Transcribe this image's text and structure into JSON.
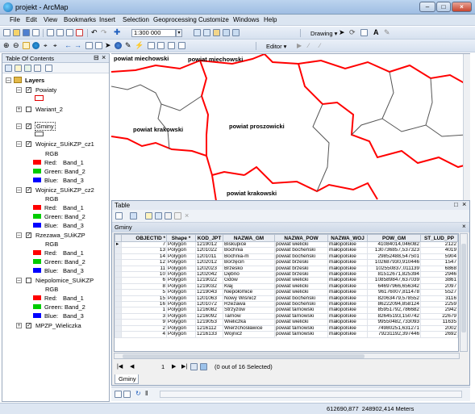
{
  "window": {
    "title": "projekt - ArcMap"
  },
  "menu": [
    "File",
    "Edit",
    "View",
    "Bookmarks",
    "Insert",
    "Selection",
    "Geoprocessing",
    "Customize",
    "Windows",
    "Help"
  ],
  "toolbar": {
    "scale": "1:300 000",
    "drawing_label": "Drawing ▾",
    "editor_label": "Editor ▾"
  },
  "toc": {
    "title": "Table Of Contents",
    "root": "Layers",
    "layers": [
      {
        "name": "Powiaty",
        "checked": true
      },
      {
        "name": "Wariant_2",
        "checked": false
      },
      {
        "name": "Gminy",
        "checked": true
      },
      {
        "name": "Wojnicz_SUiKZP_cz1",
        "checked": true,
        "rgb": "RGB",
        "bands": [
          {
            "ch": "Red:",
            "band": "Band_1"
          },
          {
            "ch": "Green:",
            "band": "Band_2"
          },
          {
            "ch": "Blue:",
            "band": "Band_3"
          }
        ]
      },
      {
        "name": "Wojnicz_SUiKZP_cz2",
        "checked": true,
        "rgb": "RGB",
        "bands": [
          {
            "ch": "Red:",
            "band": "Band_1"
          },
          {
            "ch": "Green:",
            "band": "Band_2"
          },
          {
            "ch": "Blue:",
            "band": "Band_3"
          }
        ]
      },
      {
        "name": "Rzezawa_SUiKZP",
        "checked": true,
        "rgb": "RGB",
        "bands": [
          {
            "ch": "Red:",
            "band": "Band_1"
          },
          {
            "ch": "Green:",
            "band": "Band_2"
          },
          {
            "ch": "Blue:",
            "band": "Band_3"
          }
        ]
      },
      {
        "name": "Niepolomice_SUiKZP",
        "checked": false,
        "rgb": "RGB",
        "bands": [
          {
            "ch": "Red:",
            "band": "Band_1"
          },
          {
            "ch": "Green:",
            "band": "Band_2"
          },
          {
            "ch": "Blue:",
            "band": "Band_3"
          }
        ]
      },
      {
        "name": "MPZP_Wieliczka",
        "checked": true
      }
    ]
  },
  "map": {
    "labels": [
      "powiat miechowski",
      "powiat miechowski",
      "powiat krakowski",
      "powiat proszowicki",
      "powiat krakowski"
    ]
  },
  "table": {
    "title": "Table",
    "tab": "Gminy",
    "bottom_tab": "Gminy",
    "close": "×",
    "columns": [
      "OBJECTID *",
      "Shape *",
      "KOD_JPT",
      "NAZWA_GM",
      "NAZWA_POW",
      "NAZWA_WOJ",
      "POW_GM",
      "ST_LUD_PP"
    ],
    "rows": [
      [
        "7",
        "Polygon",
        "1219012",
        "Biskupice",
        "powiat wielicki",
        "małopolskie",
        "41084014,046082",
        "2122"
      ],
      [
        "13",
        "Polygon",
        "1201022",
        "Bochnia",
        "powiat bocheński",
        "małopolskie",
        "130736857,537323",
        "4019"
      ],
      [
        "14",
        "Polygon",
        "1201011",
        "Bochnia-m",
        "powiat bocheński",
        "małopolskie",
        "29852488,547501",
        "5904"
      ],
      [
        "12",
        "Polygon",
        "1202012",
        "Borzęcin",
        "powiat brzeski",
        "małopolskie",
        "102687930,910446",
        "1547"
      ],
      [
        "11",
        "Polygon",
        "1202023",
        "Brzesko",
        "powiat brzeski",
        "małopolskie",
        "102550837,011139",
        "6868"
      ],
      [
        "10",
        "Polygon",
        "1202042",
        "Dębno",
        "powiat brzeski",
        "małopolskie",
        "81512671,825394",
        "2946"
      ],
      [
        "6",
        "Polygon",
        "1219022",
        "Gdów",
        "powiat wielicki",
        "małopolskie",
        "108589847,637039",
        "3861"
      ],
      [
        "8",
        "Polygon",
        "1219032",
        "Kłaj",
        "powiat wielicki",
        "małopolskie",
        "64697966,656342",
        "2097"
      ],
      [
        "5",
        "Polygon",
        "1219043",
        "Niepołomice",
        "powiat wielicki",
        "małopolskie",
        "96176007,811478",
        "5527"
      ],
      [
        "15",
        "Polygon",
        "1201063",
        "Nowy Wiśnicz",
        "powiat bocheński",
        "małopolskie",
        "82063479,578552",
        "3116"
      ],
      [
        "16",
        "Polygon",
        "1201072",
        "Rzezawa",
        "powiat bocheński",
        "małopolskie",
        "86222094,858124",
        "2259"
      ],
      [
        "1",
        "Polygon",
        "1216082",
        "Strzyżów",
        "powiat tarnowski",
        "małopolskie",
        "85951792,786682",
        "2942"
      ],
      [
        "3",
        "Polygon",
        "1216092",
        "Tarnów",
        "powiat tarnowski",
        "małopolskie",
        "82645193,150742",
        "22679"
      ],
      [
        "9",
        "Polygon",
        "1219053",
        "Wieliczka",
        "powiat wielicki",
        "małopolskie",
        "99550482,733093",
        "11635"
      ],
      [
        "2",
        "Polygon",
        "1216112",
        "Wierzchosławice",
        "powiat tarnowski",
        "małopolskie",
        "74980251,631271",
        "2002"
      ],
      [
        "4",
        "Polygon",
        "1216133",
        "Wojnicz",
        "powiat tarnowski",
        "małopolskie",
        "79231192,397446",
        "2692"
      ]
    ],
    "nav_current": "1",
    "selection": "(0 out of 16 Selected)"
  },
  "status": {
    "coords": "612690,877  248902,414 Meters"
  },
  "colors": {
    "red_band": "#ff0000",
    "green_band": "#00cc00",
    "blue_band": "#0000ff",
    "boundary": "#ff0000",
    "accent": "#9fbde3"
  }
}
